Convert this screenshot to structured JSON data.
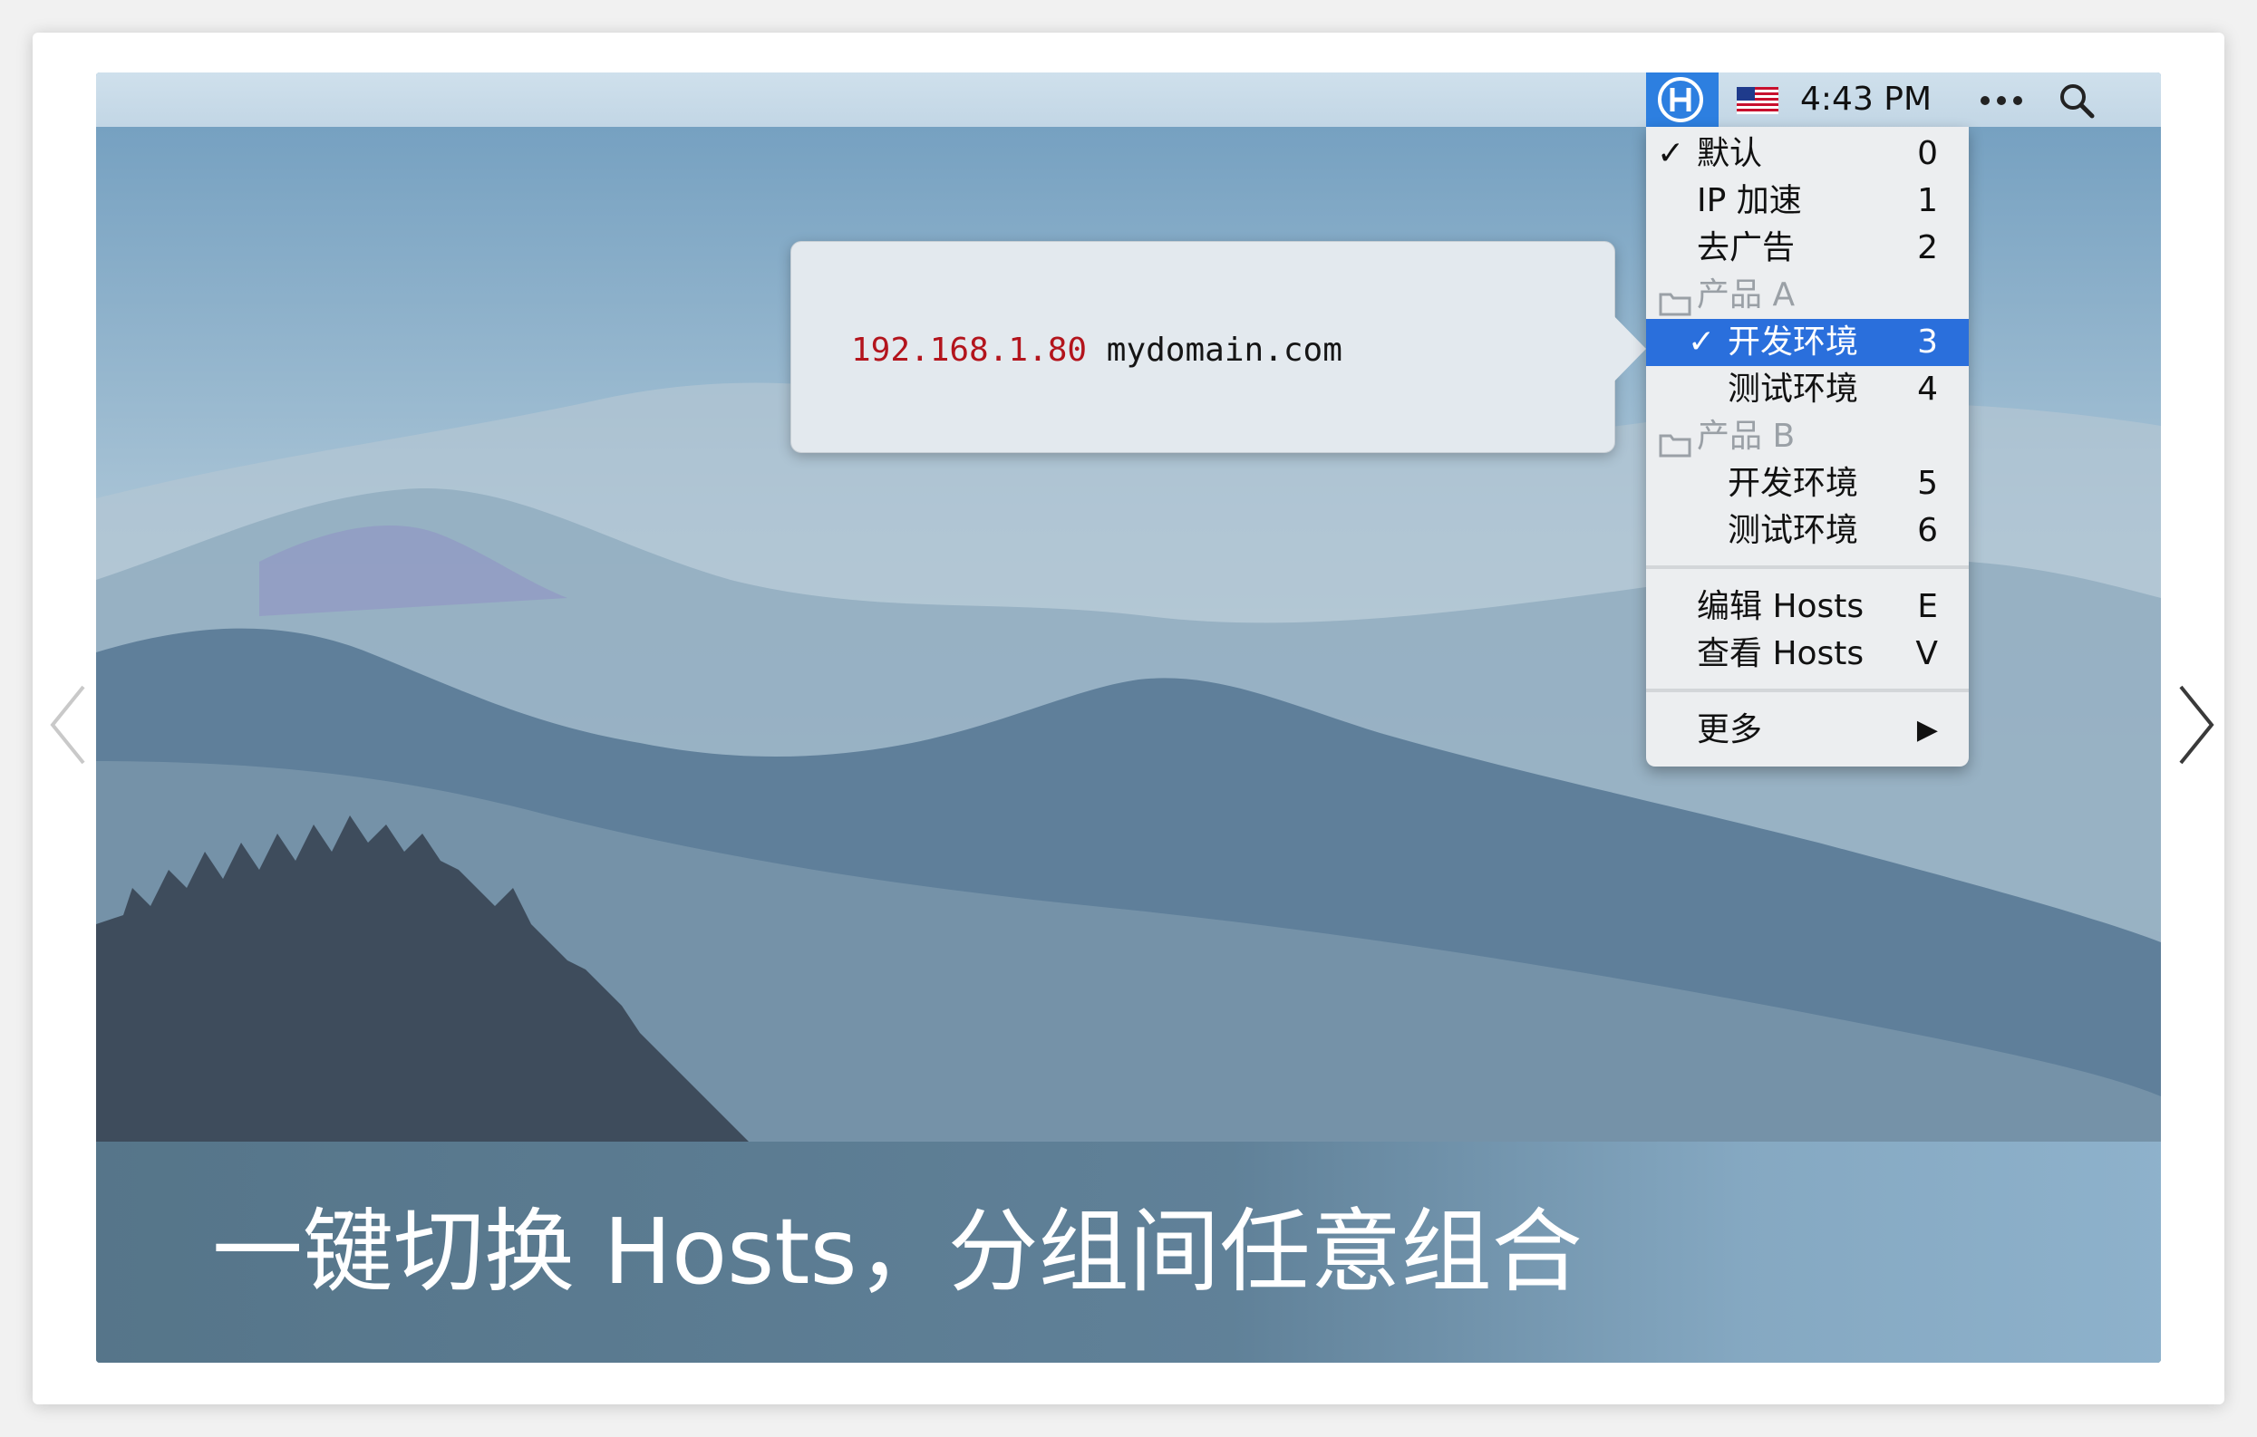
{
  "menubar": {
    "app_icon": "hosts-app-icon",
    "flag_icon": "us-flag-icon",
    "clock": "4:43 PM",
    "more_icon": "ellipsis-icon",
    "search_icon": "search-icon"
  },
  "popover": {
    "ip": "192.168.1.80",
    "domain": "mydomain.com"
  },
  "menu": {
    "items": [
      {
        "label": "默认",
        "key": "0",
        "checked": true
      },
      {
        "label": "IP 加速",
        "key": "1",
        "checked": false
      },
      {
        "label": "去广告",
        "key": "2",
        "checked": false
      },
      {
        "label": "产品 A",
        "header": true,
        "icon": "folder-icon"
      },
      {
        "label": "开发环境",
        "key": "3",
        "checked": true,
        "selected": true
      },
      {
        "label": "测试环境",
        "key": "4",
        "checked": false
      },
      {
        "label": "产品 B",
        "header": true,
        "icon": "folder-icon"
      },
      {
        "label": "开发环境",
        "key": "5",
        "checked": false
      },
      {
        "label": "测试环境",
        "key": "6",
        "checked": false
      },
      {
        "label": "编辑 Hosts",
        "key": "E"
      },
      {
        "label": "查看 Hosts",
        "key": "V"
      },
      {
        "label": "更多",
        "submenu": "▶"
      }
    ],
    "check_glyph": "✓"
  },
  "caption": "一键切换 Hosts，分组间任意组合",
  "nav": {
    "prev_icon": "chevron-left-icon",
    "next_icon": "chevron-right-icon"
  },
  "colors": {
    "accent": "#2a6fdc",
    "ip_red": "#b3141c"
  }
}
